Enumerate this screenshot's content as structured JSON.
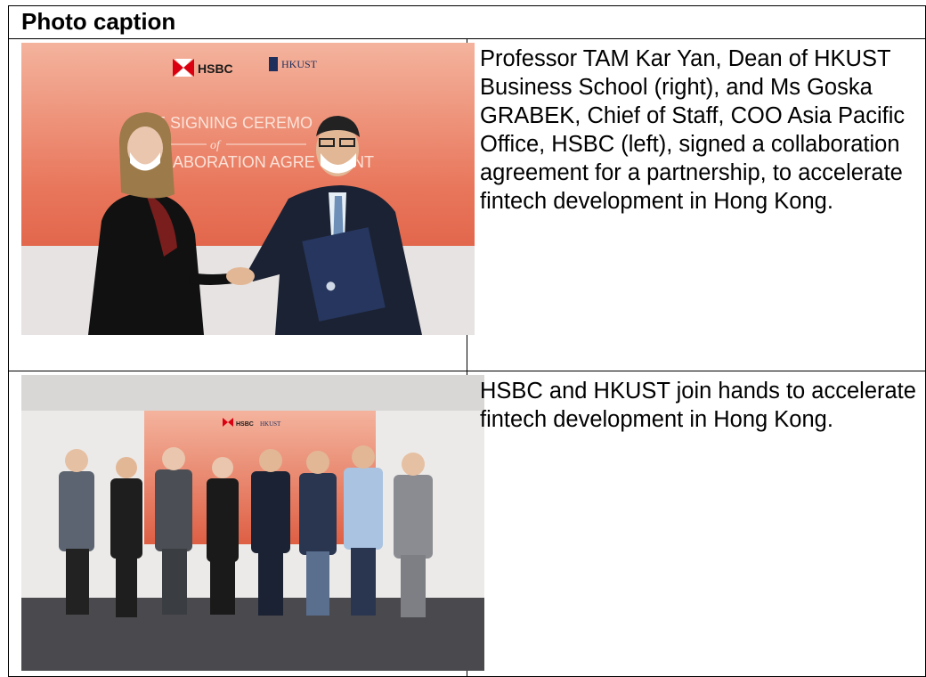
{
  "header": {
    "title": "Photo caption"
  },
  "rows": [
    {
      "photo": {
        "hsbc_logo_text": "HSBC",
        "hkust_logo_text": "HKUST",
        "backdrop_title_line1": "THE SIGNING CEREMO",
        "backdrop_of": "of",
        "backdrop_title_line2": "LLABORATION AGRE",
        "backdrop_title_line2_tail": "NT"
      },
      "caption": "Professor TAM Kar Yan, Dean of HKUST Business School (right), and Ms Goska GRABEK, Chief of Staff, COO Asia Pacific Office, HSBC (left), signed a collaboration agreement for a partnership, to accelerate fintech development in Hong Kong."
    },
    {
      "photo": {
        "hsbc_logo_text": "HSBC",
        "hkust_logo_text": "HKUST"
      },
      "caption": "HSBC and HKUST join hands to accelerate fintech development in Hong Kong."
    }
  ],
  "colors": {
    "backdrop_top": "#f2a58e",
    "backdrop_bottom": "#d94f35",
    "hsbc_red": "#db0011",
    "hkust_navy": "#1f2f5c"
  }
}
